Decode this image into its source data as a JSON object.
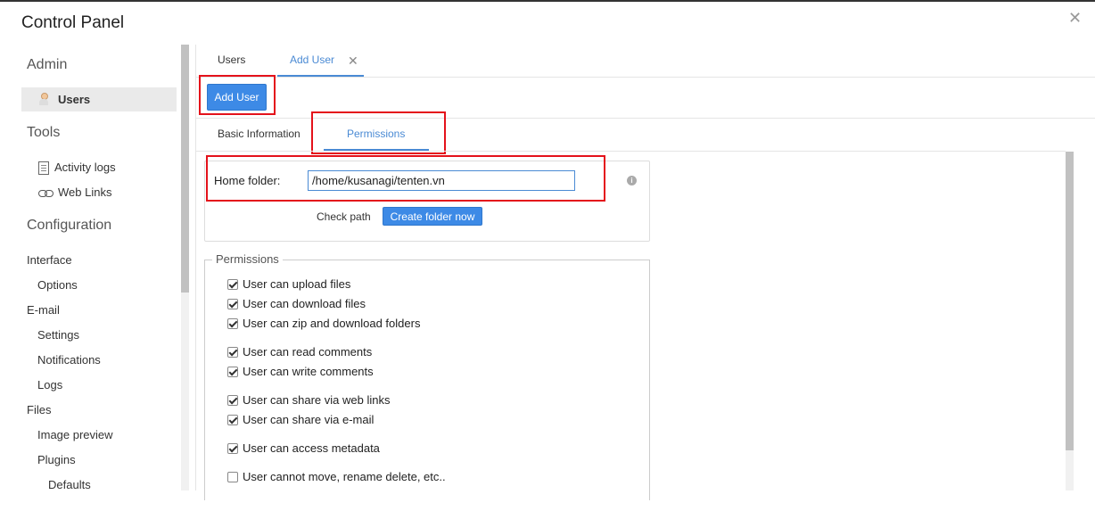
{
  "window": {
    "title": "Control Panel",
    "close_glyph": "✕"
  },
  "sidebar": {
    "sections": [
      {
        "label": "Admin"
      },
      {
        "label": "Tools"
      },
      {
        "label": "Configuration"
      }
    ],
    "admin_items": [
      {
        "label": "Users",
        "icon": "user-icon",
        "selected": true
      }
    ],
    "tools_items": [
      {
        "label": "Activity logs",
        "icon": "log-icon"
      },
      {
        "label": "Web Links",
        "icon": "link-icon"
      }
    ],
    "config_items": [
      {
        "label": "Interface",
        "level": 1
      },
      {
        "label": "Options",
        "level": 2
      },
      {
        "label": "E-mail",
        "level": 1
      },
      {
        "label": "Settings",
        "level": 2
      },
      {
        "label": "Notifications",
        "level": 2
      },
      {
        "label": "Logs",
        "level": 2
      },
      {
        "label": "Files",
        "level": 1
      },
      {
        "label": "Image preview",
        "level": 2
      },
      {
        "label": "Plugins",
        "level": 2
      },
      {
        "label": "Defaults",
        "level": 3
      }
    ]
  },
  "tabs": [
    {
      "label": "Users",
      "active": false
    },
    {
      "label": "Add User",
      "active": true,
      "closable": true
    }
  ],
  "tab_close_glyph": "✕",
  "add_user_button": "Add User",
  "subtabs": [
    {
      "label": "Basic Information",
      "active": false
    },
    {
      "label": "Permissions",
      "active": true
    }
  ],
  "home_folder": {
    "label": "Home folder:",
    "value": "/home/kusanagi/tenten.vn",
    "info_glyph": "i",
    "check_path": "Check path",
    "create_button": "Create folder now"
  },
  "permissions": {
    "legend": "Permissions",
    "items": [
      {
        "label": "User can upload files",
        "checked": true
      },
      {
        "label": "User can download files",
        "checked": true
      },
      {
        "label": "User can zip and download folders",
        "checked": true
      },
      {
        "label": "User can read comments",
        "checked": true
      },
      {
        "label": "User can write comments",
        "checked": true
      },
      {
        "label": "User can share via web links",
        "checked": true
      },
      {
        "label": "User can share via e-mail",
        "checked": true
      },
      {
        "label": "User can access metadata",
        "checked": true
      },
      {
        "label": "User cannot move, rename delete, etc..",
        "checked": false
      }
    ]
  },
  "colors": {
    "accent": "#3d8ae6",
    "highlight_box": "#e4121b"
  }
}
